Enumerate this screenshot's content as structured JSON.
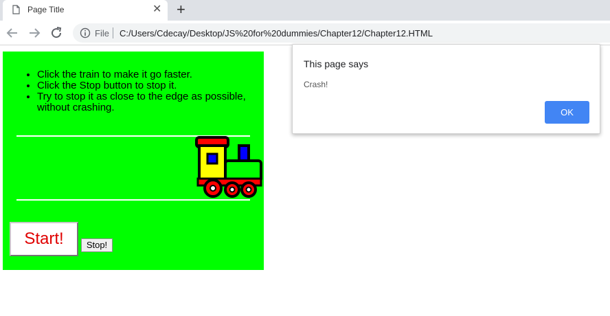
{
  "tab": {
    "title": "Page Title",
    "close_glyph": "✕",
    "new_tab_glyph": "+"
  },
  "address_bar": {
    "scheme_label": "File",
    "url": "C:/Users/Cdecay/Desktop/JS%20for%20dummies/Chapter12/Chapter12.HTML"
  },
  "page": {
    "instructions": [
      "Click the train to make it go faster.",
      "Click the Stop button to stop it.",
      "Try to stop it as close to the edge as possible, without crashing."
    ],
    "start_label": "Start!",
    "stop_label": "Stop!",
    "background_color": "#00ff00"
  },
  "dialog": {
    "title": "This page says",
    "message": "Crash!",
    "ok_label": "OK",
    "accent_color": "#4285f4"
  }
}
